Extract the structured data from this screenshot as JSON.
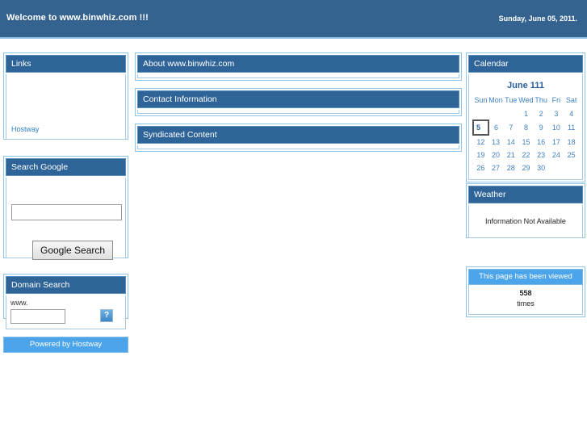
{
  "banner": {
    "title": "Welcome to www.binwhiz.com !!!",
    "date": "Sunday, June 05, 2011."
  },
  "colors": {
    "banner_bg": "#35638f",
    "panel_header_bg": "#2f6498",
    "panel_border": "#8fc4e8",
    "light_bar_bg": "#4ca4ea",
    "link_text": "#2d7fc1",
    "calendar_text": "#3f7fc1"
  },
  "left_column": {
    "links_panel": {
      "header": "Links",
      "items": [
        {
          "label": "Hostway"
        }
      ]
    },
    "google_panel": {
      "header": "Search Google",
      "input_value": "",
      "input_placeholder": "",
      "button_label": "Google Search"
    },
    "domain_panel": {
      "header": "Domain Search",
      "prefix_label": "www.",
      "input_value": "",
      "input_placeholder": "",
      "submit_icon": "broken-image-icon",
      "submit_glyph": "?"
    },
    "footer_label": "Powered by Hostway"
  },
  "center_column": {
    "panels": [
      {
        "header": "About www.binwhiz.com"
      },
      {
        "header": "Contact Information"
      },
      {
        "header": "Syndicated Content"
      }
    ]
  },
  "right_column": {
    "calendar": {
      "header": "Calendar",
      "title": "June 111",
      "weekdays": [
        "Sun",
        "Mon",
        "Tue",
        "Wed",
        "Thu",
        "Fri",
        "Sat"
      ],
      "today": 5,
      "weeks": [
        [
          "",
          "",
          "",
          "1",
          "2",
          "3",
          "4"
        ],
        [
          "5",
          "6",
          "7",
          "8",
          "9",
          "10",
          "11"
        ],
        [
          "12",
          "13",
          "14",
          "15",
          "16",
          "17",
          "18"
        ],
        [
          "19",
          "20",
          "21",
          "22",
          "23",
          "24",
          "25"
        ],
        [
          "26",
          "27",
          "28",
          "29",
          "30",
          "",
          ""
        ]
      ]
    },
    "weather": {
      "header": "Weather",
      "message": "Information Not Available"
    },
    "counter": {
      "header": "This page has been viewed",
      "count": "558",
      "unit": "times"
    }
  }
}
